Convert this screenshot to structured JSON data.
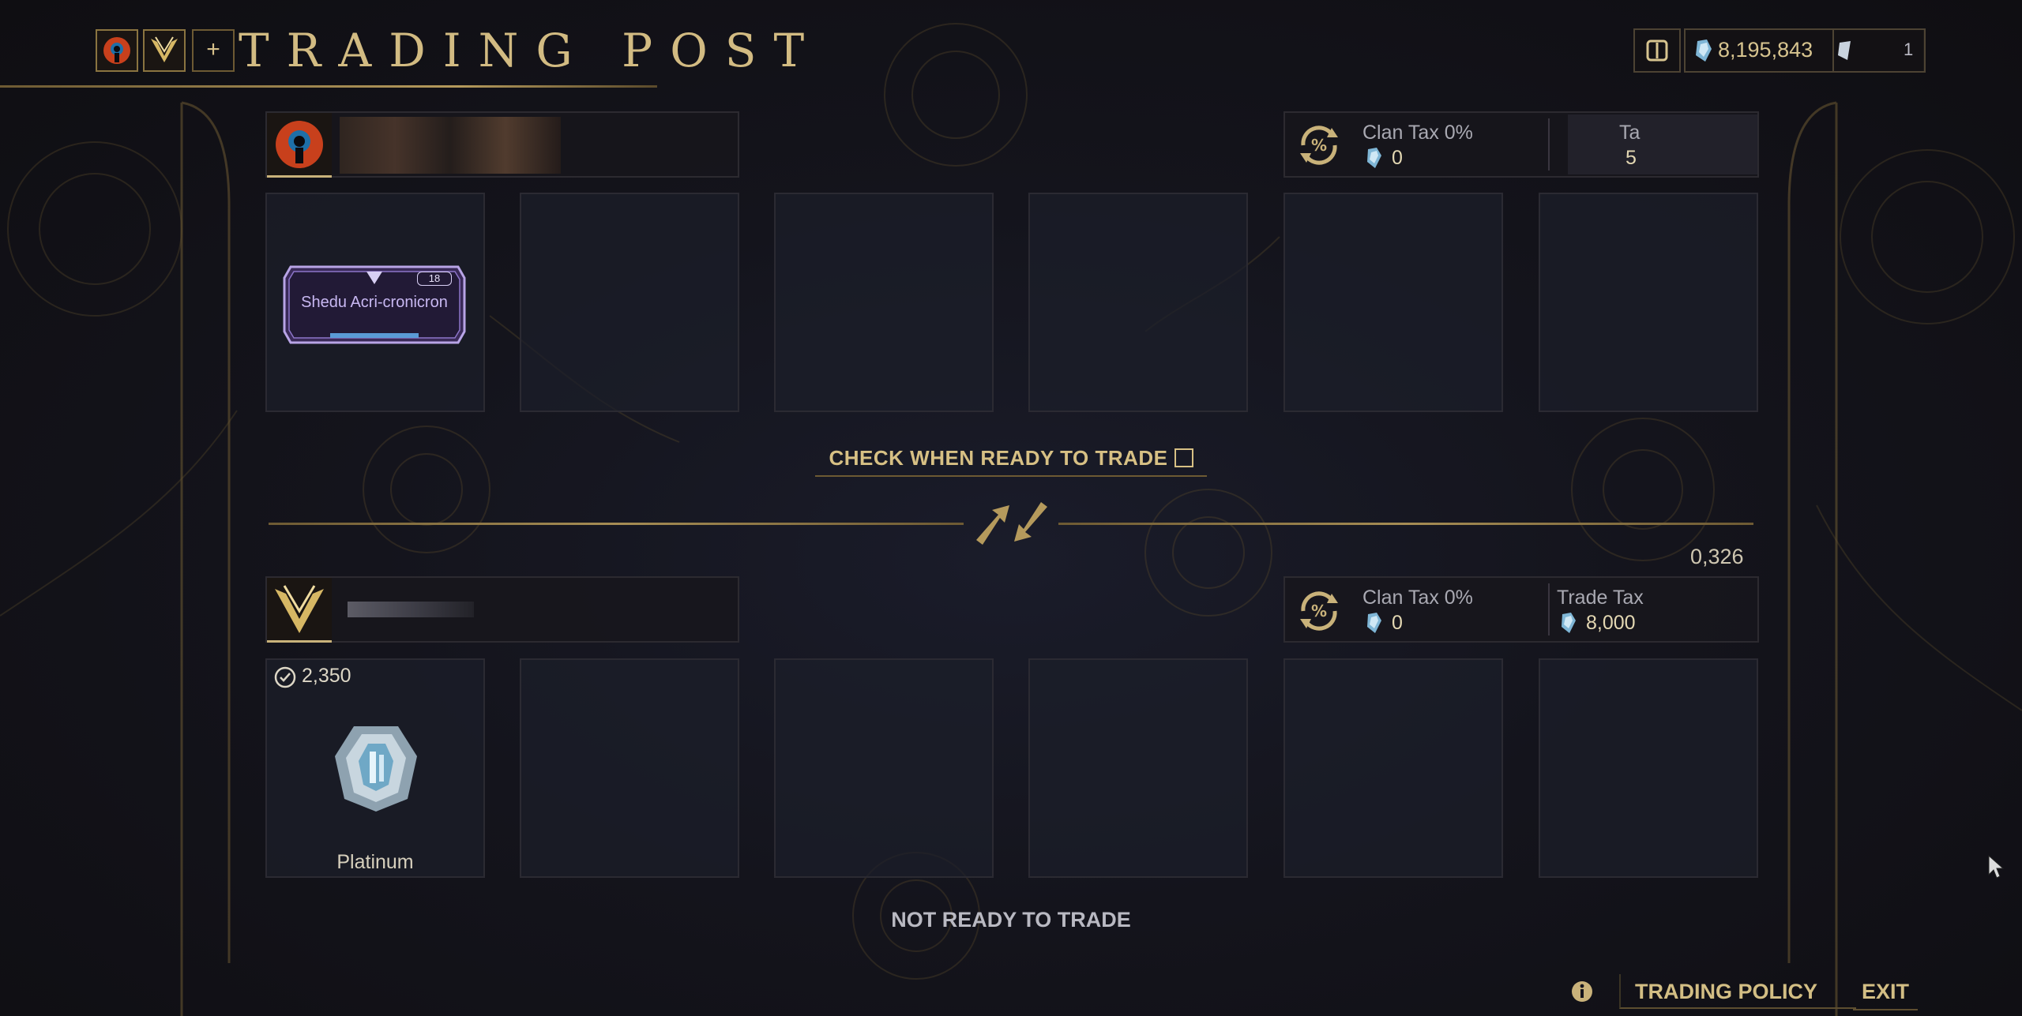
{
  "header": {
    "title": "TRADING POST",
    "plus_label": "+",
    "platinum_balance": "8,195,843",
    "secondary_currency": "1"
  },
  "top_trader": {
    "slot_item": {
      "name": "Shedu Acri-cronicron",
      "rank": "18"
    },
    "clan_tax_label": "Clan Tax 0%",
    "clan_tax_value": "0",
    "trade_tax_label_fragment": "Ta",
    "trade_tax_value_fragment": "5"
  },
  "ready_check": {
    "label": "CHECK WHEN READY TO TRADE"
  },
  "bottom_trader": {
    "partial_total": "0,326",
    "clan_tax_label": "Clan Tax 0%",
    "clan_tax_value": "0",
    "trade_tax_label": "Trade Tax",
    "trade_tax_value": "8,000",
    "slot_item": {
      "name": "Platinum",
      "count": "2,350"
    },
    "status": "NOT READY TO TRADE"
  },
  "footer": {
    "trading_policy_label": "TRADING POLICY",
    "exit_label": "EXIT"
  },
  "colors": {
    "gold": "#c9b27a",
    "background": "#14141c"
  }
}
